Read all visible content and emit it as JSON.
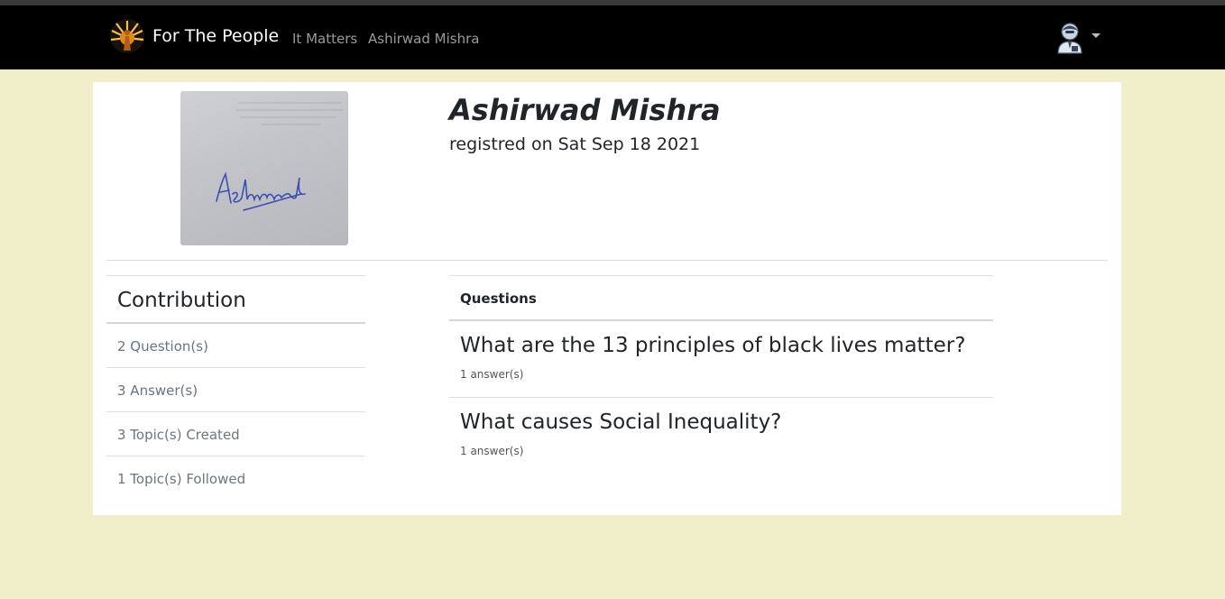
{
  "navbar": {
    "brand_label": "For The People",
    "links": [
      {
        "label": "It Matters"
      },
      {
        "label": "Ashirwad Mishra"
      }
    ],
    "logo_icon": "sunburst-logo-icon",
    "user_icon": "user-avatar-icon"
  },
  "profile": {
    "name": "Ashirwad Mishra",
    "registered_label": "registred on",
    "registered_date": "Sat Sep 18 2021"
  },
  "contribution": {
    "title": "Contribution",
    "items": [
      {
        "label": "2 Question(s)"
      },
      {
        "label": "3 Answer(s)"
      },
      {
        "label": "3 Topic(s) Created"
      },
      {
        "label": "1 Topic(s) Followed"
      }
    ]
  },
  "questions": {
    "header": "Questions",
    "items": [
      {
        "title": "What are the 13 principles of black lives matter?",
        "meta": "1 answer(s)"
      },
      {
        "title": "What causes Social Inequality?",
        "meta": "1 answer(s)"
      }
    ]
  },
  "colors": {
    "page_bg": "#f0efca",
    "navbar_bg": "#000000",
    "card_bg": "#ffffff"
  }
}
